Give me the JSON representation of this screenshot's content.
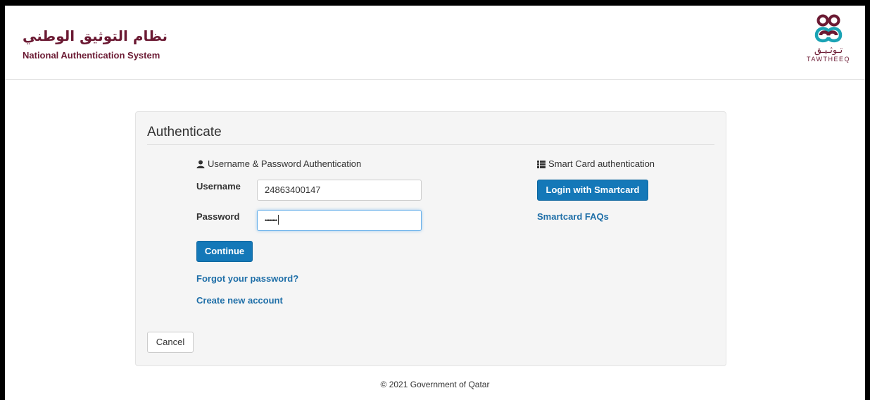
{
  "header": {
    "brand_arabic": "نظام التوثيق الوطني",
    "brand_english": "National Authentication System",
    "logo_arabic": "تـوثـيـق",
    "logo_english": "TAWTHEEQ"
  },
  "panel": {
    "title": "Authenticate",
    "password_auth": {
      "heading": "Username & Password Authentication",
      "username_label": "Username",
      "username_value": "24863400147",
      "password_label": "Password",
      "password_mask": "••••••••",
      "continue_label": "Continue",
      "forgot_link": "Forgot your password?",
      "create_link": "Create new account"
    },
    "smartcard_auth": {
      "heading": "Smart Card authentication",
      "login_label": "Login with Smartcard",
      "faq_link": "Smartcard FAQs"
    },
    "cancel_label": "Cancel"
  },
  "footer": {
    "copyright": "© 2021 Government of Qatar"
  },
  "colors": {
    "brand": "#6b1a33",
    "primary_button": "#1478b8",
    "link": "#1f6fa8",
    "logo_teal": "#1aa3b5"
  },
  "icons": {
    "user": "user-icon",
    "smartcard": "list-icon",
    "logo": "tawtheeq-logo"
  }
}
